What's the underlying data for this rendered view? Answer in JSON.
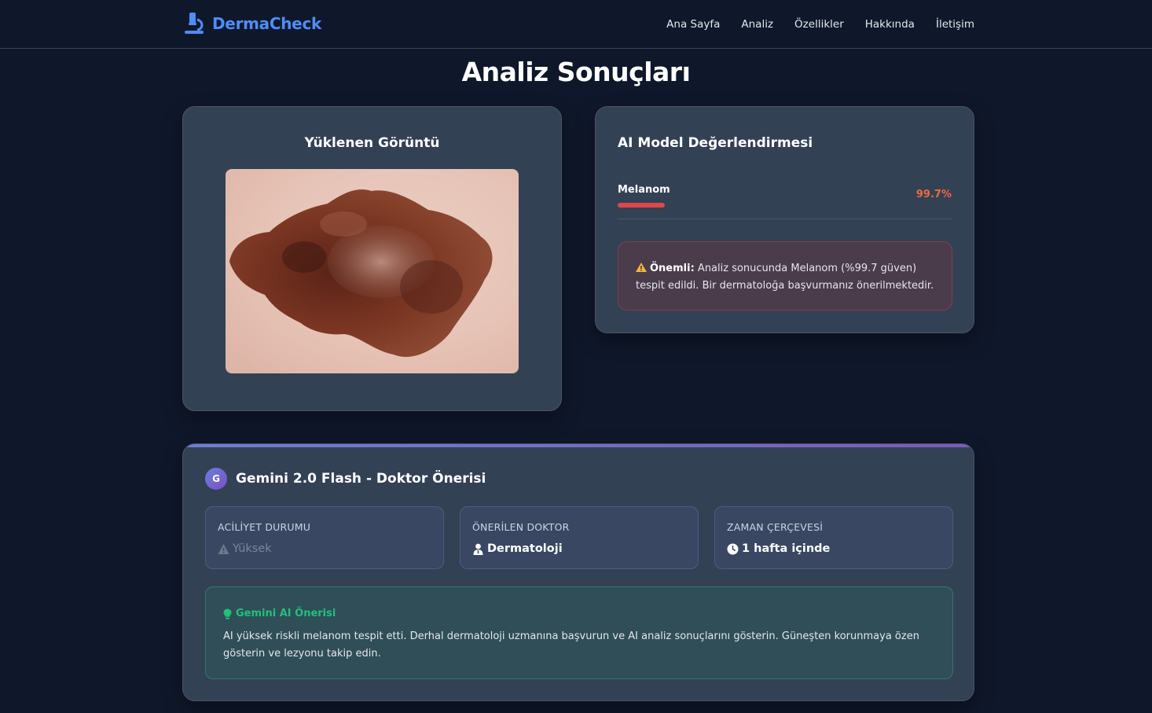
{
  "brand": {
    "name": "DermaCheck",
    "accent": "#4f8df7",
    "icon": "microscope-icon"
  },
  "nav": {
    "items": [
      "Ana Sayfa",
      "Analiz",
      "Özellikler",
      "Hakkında",
      "İletişim"
    ]
  },
  "page": {
    "title": "Analiz Sonuçları"
  },
  "uploaded": {
    "title": "Yüklenen Görüntü"
  },
  "model": {
    "title": "AI Model Değerlendirmesi",
    "prediction": {
      "label": "Melanom",
      "value_text": "99.7%",
      "confidence": 0.997
    },
    "warning": {
      "icon": "warning-icon",
      "bold": "Önemli:",
      "text": "Analiz sonucunda Melanom (%99.7 güven) tespit edildi. Bir dermatoloğa başvurmanız önerilmektedir."
    }
  },
  "gemini": {
    "avatar": "G",
    "title": "Gemini 2.0 Flash - Doktor Önerisi",
    "info": [
      {
        "label": "ACİLİYET DURUMU",
        "value": "Yüksek",
        "icon": "warning-icon"
      },
      {
        "label": "ÖNERİLEN DOKTOR",
        "value": "Dermatoloji",
        "icon": "doctor-icon"
      },
      {
        "label": "ZAMAN ÇERÇEVESİ",
        "value": "1 hafta içinde",
        "icon": "clock-icon"
      }
    ],
    "recommendation": {
      "icon": "lightbulb-icon",
      "title": "Gemini AI Önerisi",
      "text": "AI yüksek riskli melanom tespit etti. Derhal dermatoloji uzmanına başvurun ve AI analiz sonuçlarını gösterin. Güneşten korunmaya özen gösterin ve lezyonu takip edin."
    }
  },
  "colors": {
    "background": "#0f172a",
    "card": "#334155",
    "danger": "#e04848",
    "success": "#22c07e"
  }
}
